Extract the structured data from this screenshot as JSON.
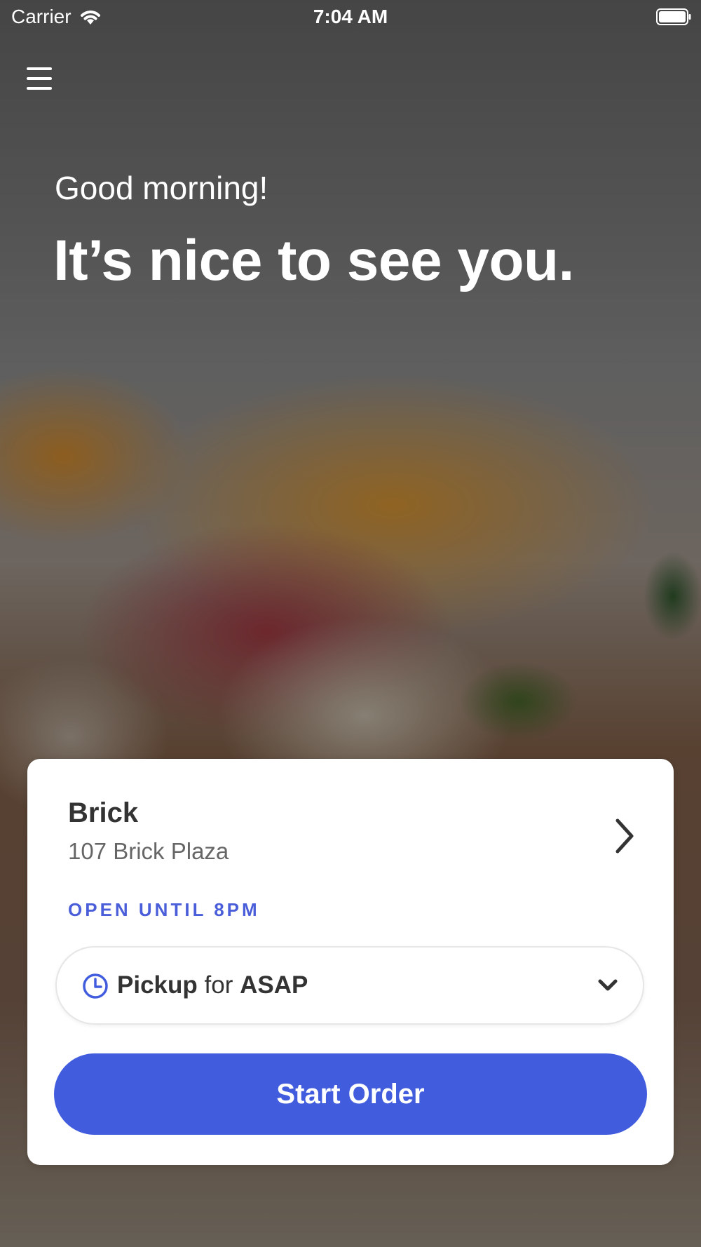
{
  "status_bar": {
    "carrier": "Carrier",
    "time": "7:04 AM"
  },
  "icons": {
    "menu": "hamburger-menu-icon",
    "wifi": "wifi-icon",
    "battery": "battery-icon",
    "store_arrow": "chevron-right-icon",
    "clock": "clock-icon",
    "dropdown": "chevron-down-icon"
  },
  "hero": {
    "greeting": "Good morning!",
    "headline": "It’s nice to see you."
  },
  "store": {
    "name": "Brick",
    "address": "107 Brick Plaza",
    "hours": "OPEN UNTIL 8PM"
  },
  "order_mode": {
    "type": "Pickup",
    "connector": "for",
    "time": "ASAP"
  },
  "actions": {
    "start_order": "Start Order"
  },
  "colors": {
    "accent": "#415ddd",
    "hours_text": "#4a5ed9",
    "card_bg": "#ffffff"
  }
}
